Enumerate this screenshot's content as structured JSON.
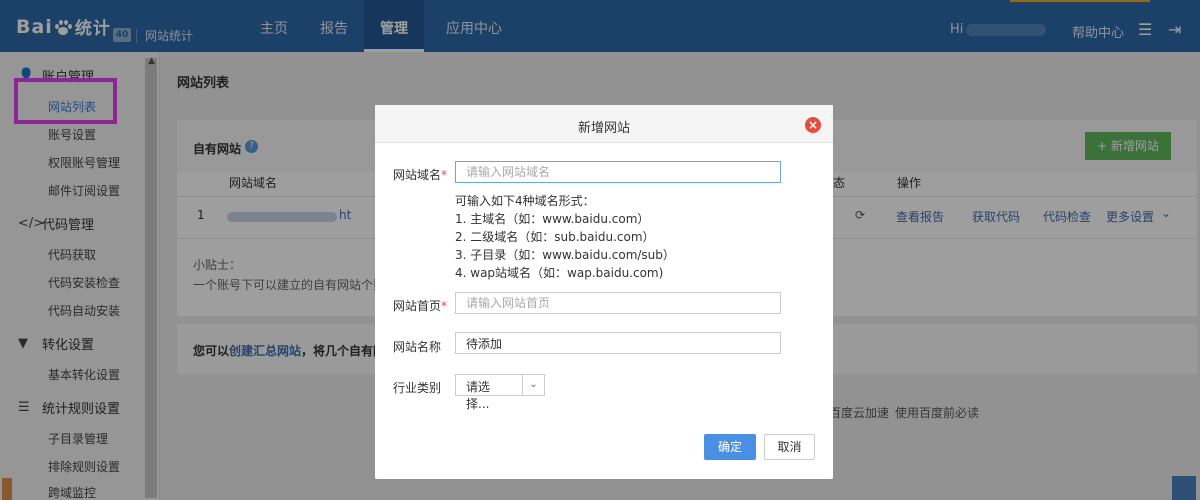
{
  "header": {
    "logo_text_a": "Bai",
    "logo_text_b": "du",
    "logo_cn": "统计",
    "version_badge": "40",
    "site_label": "网站统计",
    "nav": [
      "主页",
      "报告",
      "管理",
      "应用中心"
    ],
    "active_nav": "管理",
    "greeting": "Hi s",
    "help": "帮助中心",
    "accent_color": "#2e6aa8"
  },
  "sidebar": {
    "groups": [
      {
        "label": "账户管理",
        "icon": "user-icon",
        "items": [
          "网站列表",
          "账号设置",
          "权限账号管理",
          "邮件订阅设置"
        ]
      },
      {
        "label": "代码管理",
        "icon": "code-icon",
        "items": [
          "代码获取",
          "代码安装检查",
          "代码自动安装"
        ]
      },
      {
        "label": "转化设置",
        "icon": "filter-icon",
        "items": [
          "基本转化设置"
        ]
      },
      {
        "label": "统计规则设置",
        "icon": "sliders-icon",
        "items": [
          "子目录管理",
          "排除规则设置",
          "跨域监控"
        ]
      }
    ],
    "active_item": "网站列表"
  },
  "main": {
    "title": "网站列表",
    "own_sites": "自有网站",
    "add_site": "+ 新增网站",
    "col_domain": "网站域名",
    "col_partial": "态",
    "col_actions": "操作",
    "row_index": "1",
    "row_partial": "ht",
    "action_view": "查看报告",
    "action_get_code": "获取代码",
    "action_check_code": "代码检查",
    "action_more": "更多设置",
    "tip_title": "小贴士：",
    "tip_text": "一个账号下可以建立的自有网站个数上",
    "summary_prefix": "您可以",
    "summary_link": "创建汇总网站",
    "summary_suffix": "，将几个自有网站",
    "footer_a": "百度云加速",
    "footer_b": "使用百度前必读"
  },
  "modal": {
    "title": "新增网站",
    "domain_label": "网站域名",
    "domain_placeholder": "请输入网站域名",
    "hint_title": "可输入如下4种域名形式：",
    "hints": [
      "1. 主域名（如：www.baidu.com）",
      "2. 二级域名（如：sub.baidu.com）",
      "3. 子目录（如：www.baidu.com/sub）",
      "4. wap站域名（如：wap.baidu.com)"
    ],
    "home_label": "网站首页",
    "home_placeholder": "请输入网站首页",
    "name_label": "网站名称",
    "name_value": "待添加",
    "industry_label": "行业类别",
    "industry_value": "请选择...",
    "ok": "确定",
    "cancel": "取消",
    "required_mark": "*"
  }
}
